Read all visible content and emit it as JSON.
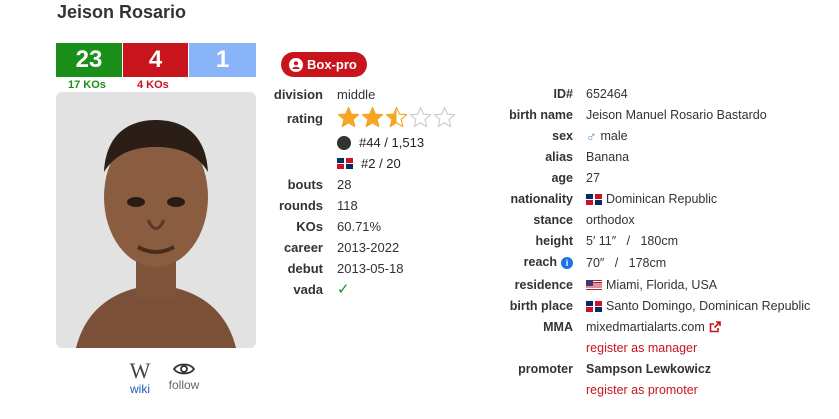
{
  "boxer": {
    "name": "Jeison Rosario"
  },
  "record": {
    "wins": "23",
    "losses": "4",
    "draws": "1",
    "win_kos": "17 KOs",
    "loss_kos": "4 KOs"
  },
  "links": {
    "wiki": "wiki",
    "follow": "follow"
  },
  "badge": "Box-pro",
  "left": {
    "division_label": "division",
    "division": "middle",
    "rating_label": "rating",
    "rating_stars": 2.5,
    "rating_max": 5,
    "world_rank": "#44 / 1,513",
    "country_rank": "#2 / 20",
    "bouts_label": "bouts",
    "bouts": "28",
    "rounds_label": "rounds",
    "rounds": "118",
    "kos_label": "KOs",
    "kos": "60.71%",
    "career_label": "career",
    "career": "2013-2022",
    "debut_label": "debut",
    "debut": "2013-05-18",
    "vada_label": "vada",
    "vada": "✓"
  },
  "right": {
    "id_label": "ID#",
    "id": "652464",
    "birth_name_label": "birth name",
    "birth_name": "Jeison Manuel Rosario Bastardo",
    "sex_label": "sex",
    "sex_symbol": "♂",
    "sex": "male",
    "alias_label": "alias",
    "alias": "Banana",
    "age_label": "age",
    "age": "27",
    "nationality_label": "nationality",
    "nationality": "Dominican Republic",
    "stance_label": "stance",
    "stance": "orthodox",
    "height_label": "height",
    "height": "5′ 11″   /   180cm",
    "reach_label": "reach",
    "reach_info": "i",
    "reach": "70″   /   178cm",
    "residence_label": "residence",
    "residence": "Miami, Florida, USA",
    "birth_place_label": "birth place",
    "birth_place": "Santo Domingo, Dominican Republic",
    "mma_label": "MMA",
    "mma": "mixedmartialarts.com",
    "register_manager": "register as manager",
    "promoter_label": "promoter",
    "promoter": "Sampson Lewkowicz",
    "register_promoter": "register as promoter"
  },
  "colors": {
    "win": "#1a8f1a",
    "loss": "#c8141c",
    "draw": "#8ab4f8",
    "star": "#f5a623",
    "link": "#c8141c"
  }
}
